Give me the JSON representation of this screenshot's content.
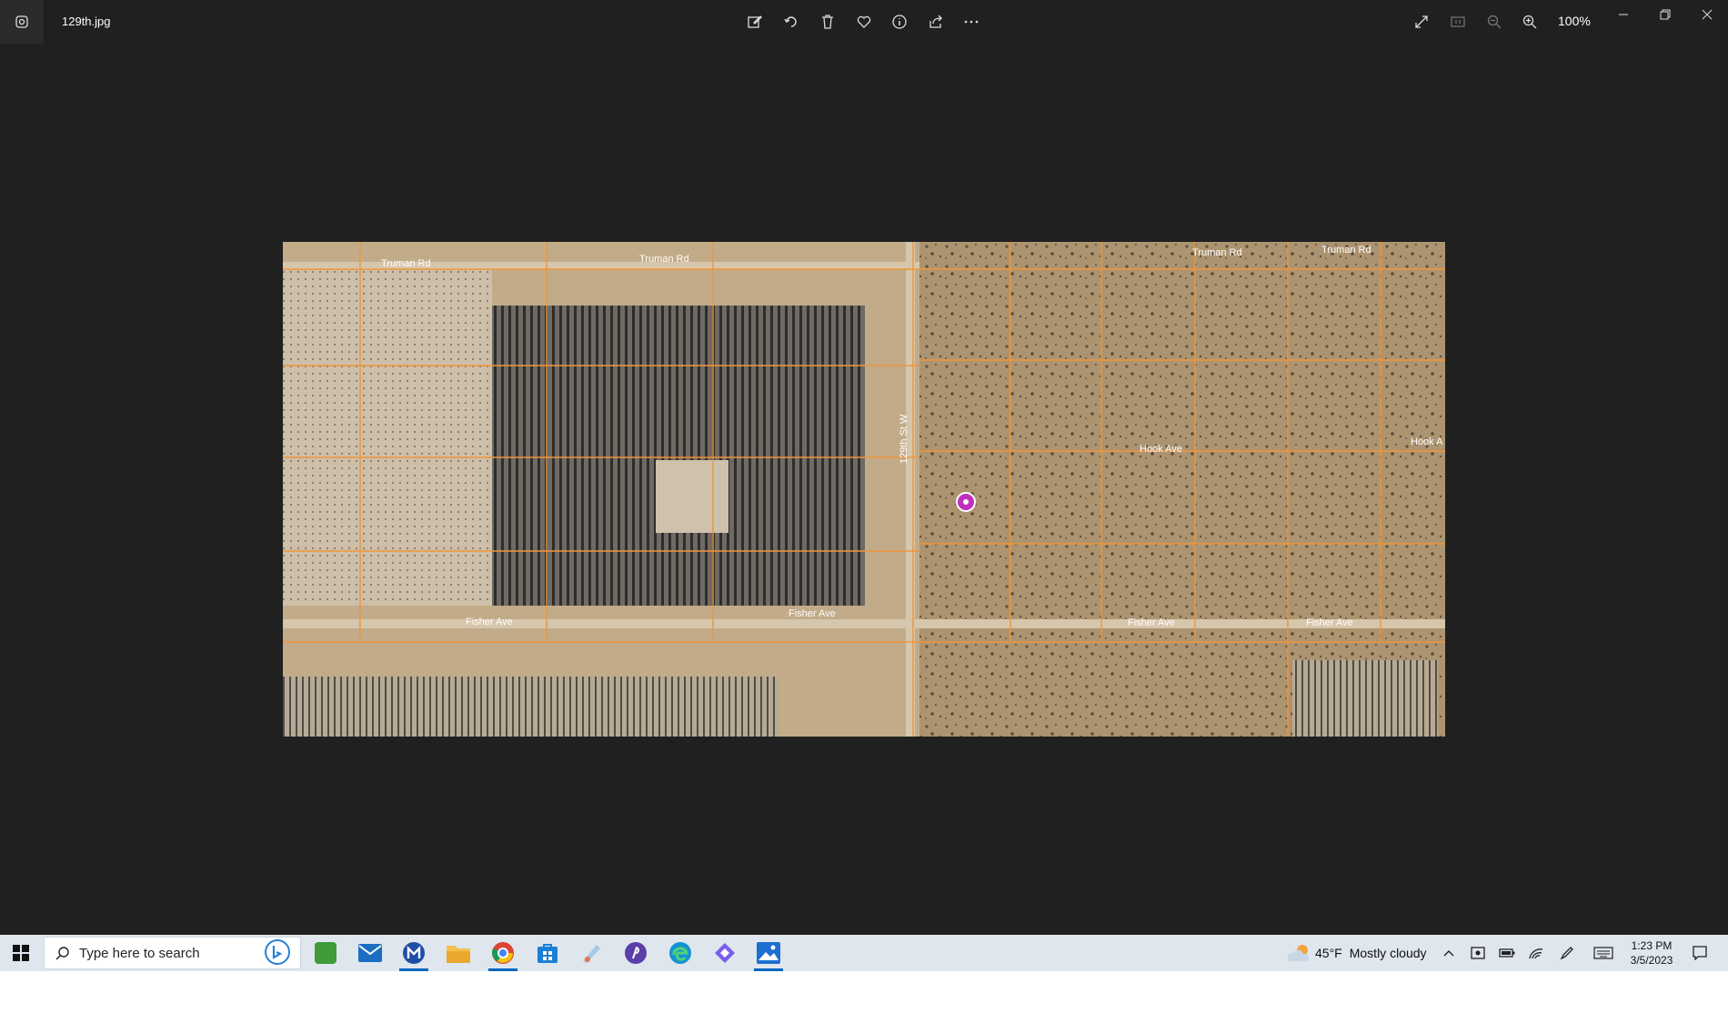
{
  "titlebar": {
    "file_name": "129th.jpg",
    "zoom_level": "100%",
    "toolbar_icons": [
      "edit-image-icon",
      "rotate-icon",
      "delete-icon",
      "favorite-icon",
      "info-icon",
      "share-icon",
      "more-icon"
    ],
    "right_icons": [
      "fullscreen-icon",
      "actual-size-icon",
      "zoom-out-icon",
      "zoom-in-icon"
    ]
  },
  "map": {
    "labels": {
      "truman_1": "Truman Rd",
      "truman_2": "Truman Rd",
      "truman_3": "Truman Rd",
      "truman_4": "Truman Rd",
      "hook_1": "Hook Ave",
      "hook_2": "Hook A",
      "fisher_1": "Fisher Ave",
      "fisher_2": "Fisher Ave",
      "fisher_3": "Fisher Ave",
      "fisher_4": "Fisher Ave",
      "st_129": "129th St W"
    },
    "colors": {
      "ground": "#b59c7a",
      "parcel_lines": "#f0953a",
      "marker": "#c22fbf"
    }
  },
  "taskbar": {
    "search_placeholder": "Type here to search",
    "apps": [
      "solitaire-icon",
      "mail-icon",
      "malwarebytes-icon",
      "file-explorer-icon",
      "chrome-icon",
      "store-icon",
      "paint-icon",
      "vpn-icon",
      "edge-icon",
      "copilot-icon",
      "photos-icon"
    ],
    "weather": {
      "temp": "45°F",
      "condition": "Mostly cloudy"
    },
    "clock": {
      "time": "1:23 PM",
      "date": "3/5/2023"
    }
  }
}
